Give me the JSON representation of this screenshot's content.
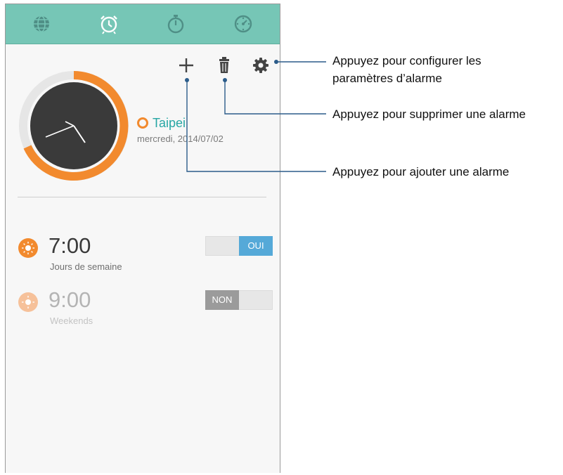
{
  "tabs": [
    {
      "name": "world-clock",
      "icon": "globe-icon",
      "active": false
    },
    {
      "name": "alarm",
      "icon": "alarm-clock-icon",
      "active": true
    },
    {
      "name": "stopwatch",
      "icon": "stopwatch-icon",
      "active": false
    },
    {
      "name": "timer",
      "icon": "timer-icon",
      "active": false
    }
  ],
  "toolbar": {
    "add_icon": "plus-icon",
    "delete_icon": "trash-icon",
    "settings_icon": "gear-icon"
  },
  "clock": {
    "city": "Taipei",
    "date": "mercredi, 2014/07/02"
  },
  "alarms": [
    {
      "time": "7:00",
      "days": "Jours de semaine",
      "state": "OUI",
      "enabled": true
    },
    {
      "time": "9:00",
      "days": "Weekends",
      "state": "NON",
      "enabled": false
    }
  ],
  "callouts": {
    "settings": "Appuyez pour configurer les\nparamètres d’alarme",
    "delete": "Appuyez pour supprimer une alarme",
    "add": "Appuyez pour ajouter une alarme"
  },
  "colors": {
    "tabbar": "#76c6b6",
    "accent_orange": "#f28a2e",
    "accent_teal": "#27a6a4",
    "toggle_on": "#55a9d8",
    "toggle_off": "#9b9b9b",
    "clock_face": "#3a3a3a"
  }
}
